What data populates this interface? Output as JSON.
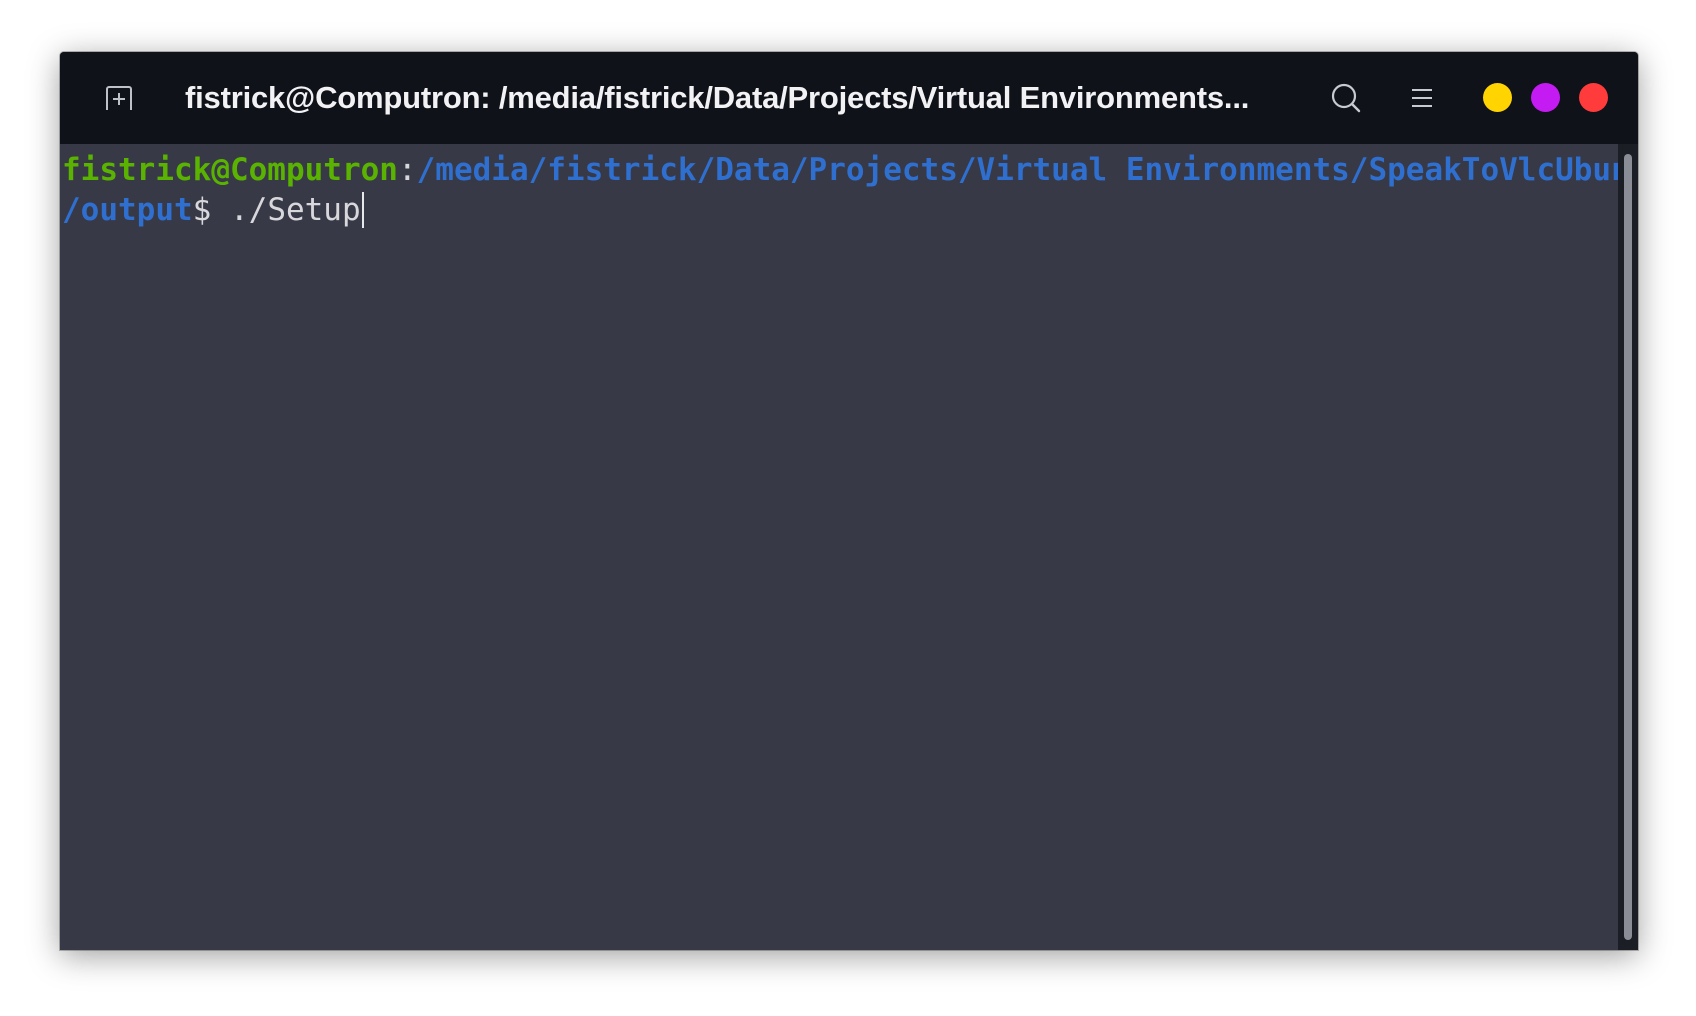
{
  "window": {
    "title": "fistrick@Computron: /media/fistrick/Data/Projects/Virtual Environments..."
  },
  "titlebar": {
    "new_tab_icon": "new-tab-icon",
    "search_icon": "search-icon",
    "menu_icon": "hamburger-menu-icon",
    "window_controls": {
      "minimize_color": "#ffd400",
      "maximize_color": "#c41bf2",
      "close_color": "#ff3b3b"
    }
  },
  "terminal": {
    "user_host": "fistrick@Computron",
    "separator": ":",
    "path_line1": "/media/fistrick/Data/Projects/Virtual Environments/SpeakToVlcUbuntu",
    "path_line2": "/output",
    "prompt_symbol": "$",
    "command": " ./Setup",
    "colors": {
      "background": "#373946",
      "user_host": "#59b300",
      "path": "#2f6fd0",
      "text": "#d8d8dc"
    }
  }
}
